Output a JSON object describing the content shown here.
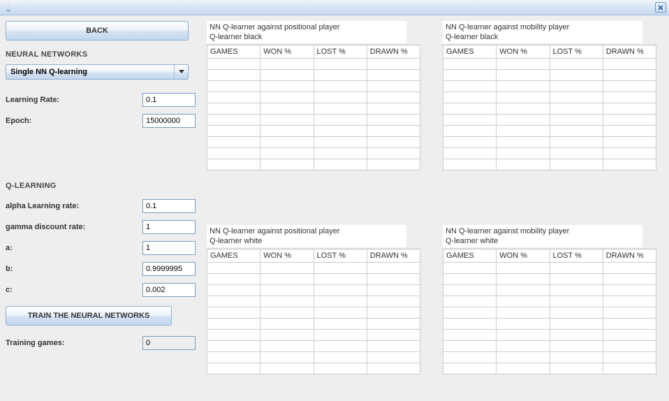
{
  "window": {
    "close_tooltip": "Close"
  },
  "buttons": {
    "back": "BACK",
    "train": "TRAIN THE NEURAL NETWORKS"
  },
  "sections": {
    "neural_networks": "NEURAL NETWORKS",
    "q_learning": "Q-LEARNING"
  },
  "combo": {
    "selected": "Single NN Q-learning"
  },
  "nn_fields": {
    "learning_rate_label": "Learning Rate:",
    "learning_rate_value": "0.1",
    "epoch_label": "Epoch:",
    "epoch_value": "15000000"
  },
  "q_fields": {
    "alpha_label": "alpha Learning rate:",
    "alpha_value": "0.1",
    "gamma_label": "gamma discount rate:",
    "gamma_value": "1",
    "a_label": "a:",
    "a_value": "1",
    "b_label": "b:",
    "b_value": "0.9999995",
    "c_label": "c:",
    "c_value": "0.002",
    "training_games_label": "Training games:",
    "training_games_value": "0"
  },
  "tables": {
    "columns": [
      "GAMES",
      "WON %",
      "LOST %",
      "DRAWN %"
    ],
    "t1": {
      "title_l1": "NN Q-learner against positional player",
      "title_l2": "Q-learner black"
    },
    "t2": {
      "title_l1": "NN Q-learner against mobility player",
      "title_l2": "Q-learner black"
    },
    "t3": {
      "title_l1": "NN Q-learner against positional player",
      "title_l2": "Q-learner white"
    },
    "t4": {
      "title_l1": "NN Q-learner against mobility player",
      "title_l2": "Q-learner white"
    }
  }
}
